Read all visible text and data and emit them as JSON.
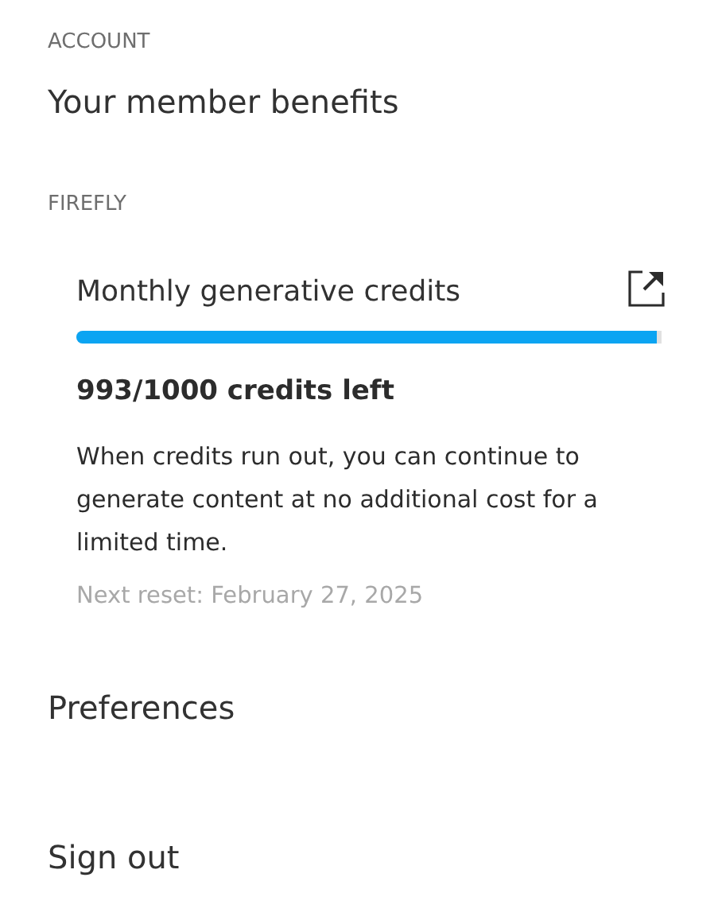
{
  "section_label": "ACCOUNT",
  "title": "Your member benefits",
  "group_label": "FIREFLY",
  "credits": {
    "name": "Monthly generative credits",
    "level": 0.993,
    "count": "993/1000 credits left",
    "description": "When credits run out, you can continue to generate content at no additional cost for a limited time.",
    "reset": "Next reset: February 27, 2025"
  },
  "links": [
    "Preferences",
    "Sign out"
  ]
}
